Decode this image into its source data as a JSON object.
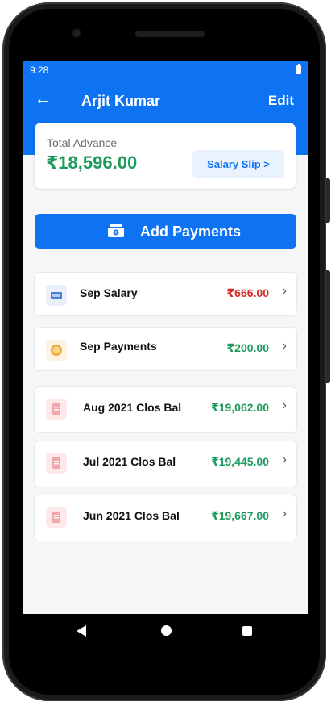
{
  "status_bar": {
    "time": "9:28"
  },
  "header": {
    "title": "Arjit Kumar",
    "edit_label": "Edit"
  },
  "advance": {
    "label": "Total Advance",
    "amount": "₹18,596.00",
    "slip_button": "Salary Slip >"
  },
  "add_payments": {
    "label": "Add Payments"
  },
  "colors": {
    "primary": "#0d73f2",
    "positive": "#1e9a5d",
    "negative": "#d62828"
  },
  "entries": [
    {
      "label": "Sep Salary",
      "amount": "₹666.00",
      "tone": "negative",
      "icon": "salary-icon"
    },
    {
      "label": "Sep Payments",
      "amount": "₹200.00",
      "tone": "positive",
      "icon": "coin-icon"
    },
    {
      "label": "Aug 2021 Clos Bal",
      "amount": "₹19,062.00",
      "tone": "positive",
      "icon": "receipt-icon"
    },
    {
      "label": "Jul 2021 Clos Bal",
      "amount": "₹19,445.00",
      "tone": "positive",
      "icon": "receipt-icon"
    },
    {
      "label": "Jun 2021 Clos Bal",
      "amount": "₹19,667.00",
      "tone": "positive",
      "icon": "receipt-icon"
    }
  ]
}
